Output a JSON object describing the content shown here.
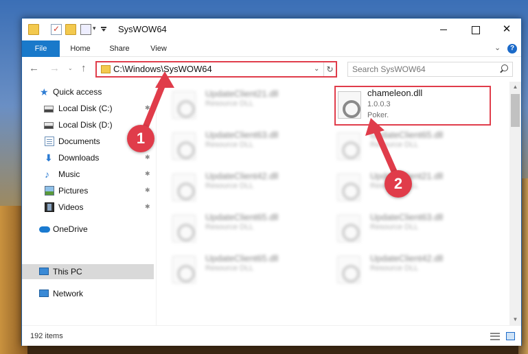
{
  "window": {
    "title": "SysWOW64",
    "controls": {
      "minimize": "",
      "maximize": "",
      "close": "✕"
    }
  },
  "ribbon": {
    "tabs": [
      {
        "label": "File"
      },
      {
        "label": "Home"
      },
      {
        "label": "Share"
      },
      {
        "label": "View"
      }
    ],
    "expand": "⌄",
    "help": "?"
  },
  "nav": {
    "back": "←",
    "forward": "→",
    "recent": "⌄",
    "up": "↑",
    "address": "C:\\Windows\\SysWOW64",
    "address_dropdown": "⌄",
    "refresh": "↻",
    "search_placeholder": "Search SysWOW64"
  },
  "sidebar": {
    "items": [
      {
        "label": "Quick access",
        "icon": "star-icon",
        "pinned": false
      },
      {
        "label": "Local Disk (C:)",
        "icon": "drive-icon",
        "pinned": true
      },
      {
        "label": "Local Disk (D:)",
        "icon": "drive-icon",
        "pinned": false
      },
      {
        "label": "Documents",
        "icon": "documents-icon",
        "pinned": false
      },
      {
        "label": "Downloads",
        "icon": "download-icon",
        "pinned": true
      },
      {
        "label": "Music",
        "icon": "music-icon",
        "pinned": true
      },
      {
        "label": "Pictures",
        "icon": "pictures-icon",
        "pinned": true
      },
      {
        "label": "Videos",
        "icon": "videos-icon",
        "pinned": true
      },
      {
        "label": "OneDrive",
        "icon": "onedrive-icon",
        "pinned": false
      },
      {
        "label": "This PC",
        "icon": "computer-icon",
        "pinned": false,
        "selected": true
      },
      {
        "label": "Network",
        "icon": "network-icon",
        "pinned": false
      }
    ],
    "pin_glyph": "📌"
  },
  "files": [
    {
      "name": "UpdateClient21.dll",
      "type": "Resource DLL",
      "blurred": true
    },
    {
      "name": "chameleon.dll",
      "version": "1.0.0.3",
      "company": "Poker.",
      "highlighted": true
    },
    {
      "name": "UpdateClient63.dll",
      "type": "Resource DLL",
      "blurred": true
    },
    {
      "name": "UpdateClient65.dll",
      "type": "Resource DLL",
      "blurred": true
    },
    {
      "name": "UpdateClient42.dll",
      "type": "Resource DLL",
      "blurred": true
    },
    {
      "name": "UpdateClient21.dll",
      "type": "Resource DLL",
      "blurred": true
    },
    {
      "name": "UpdateClient65.dll",
      "type": "Resource DLL",
      "blurred": true
    },
    {
      "name": "UpdateClient63.dll",
      "type": "Resource DLL",
      "blurred": true
    },
    {
      "name": "UpdateClient65.dll",
      "type": "Resource DLL",
      "blurred": true
    },
    {
      "name": "UpdateClient42.dll",
      "type": "Resource DLL",
      "blurred": true
    }
  ],
  "status": {
    "items_count": "192 items"
  },
  "annotations": [
    {
      "number": "1"
    },
    {
      "number": "2"
    }
  ],
  "colors": {
    "accent": "#1979ca",
    "annotation": "#e03c4a"
  }
}
